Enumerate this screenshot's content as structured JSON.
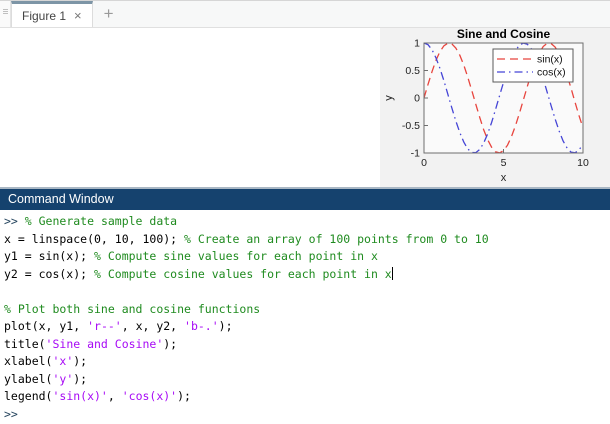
{
  "tab_bar": {
    "tabs": [
      {
        "label": "Figure 1",
        "close_glyph": "×",
        "active": true
      }
    ],
    "new_tab_glyph": "+"
  },
  "command_window": {
    "title": "Command Window",
    "lines": [
      [
        {
          "t": "prompt",
          "x": ">> "
        },
        {
          "t": "comment",
          "x": "% Generate sample data"
        }
      ],
      [
        {
          "t": "code",
          "x": "x = linspace(0, 10, 100); "
        },
        {
          "t": "comment",
          "x": "% Create an array of 100 points from 0 to 10"
        }
      ],
      [
        {
          "t": "code",
          "x": "y1 = sin(x); "
        },
        {
          "t": "comment",
          "x": "% Compute sine values for each point in x"
        }
      ],
      [
        {
          "t": "code",
          "x": "y2 = cos(x); "
        },
        {
          "t": "comment",
          "x": "% Compute cosine values for each point in x"
        },
        {
          "t": "cursor",
          "x": ""
        }
      ],
      [],
      [
        {
          "t": "comment",
          "x": "% Plot both sine and cosine functions"
        }
      ],
      [
        {
          "t": "code",
          "x": "plot(x, y1, "
        },
        {
          "t": "string",
          "x": "'r--'"
        },
        {
          "t": "code",
          "x": ", x, y2, "
        },
        {
          "t": "string",
          "x": "'b-.'"
        },
        {
          "t": "code",
          "x": ");"
        }
      ],
      [
        {
          "t": "code",
          "x": "title("
        },
        {
          "t": "string",
          "x": "'Sine and Cosine'"
        },
        {
          "t": "code",
          "x": ");"
        }
      ],
      [
        {
          "t": "code",
          "x": "xlabel("
        },
        {
          "t": "string",
          "x": "'x'"
        },
        {
          "t": "code",
          "x": ");"
        }
      ],
      [
        {
          "t": "code",
          "x": "ylabel("
        },
        {
          "t": "string",
          "x": "'y'"
        },
        {
          "t": "code",
          "x": ");"
        }
      ],
      [
        {
          "t": "code",
          "x": "legend("
        },
        {
          "t": "string",
          "x": "'sin(x)'"
        },
        {
          "t": "code",
          "x": ", "
        },
        {
          "t": "string",
          "x": "'cos(x)'"
        },
        {
          "t": "code",
          "x": ");"
        }
      ],
      [
        {
          "t": "prompt",
          "x": ">>"
        }
      ]
    ]
  },
  "colors": {
    "prompt": "#27465f",
    "code": "#000000",
    "comment": "#1f8b1f",
    "string": "#a709f5",
    "header_bg": "#15426e",
    "tab_accent": "#7d95a6"
  },
  "chart_data": {
    "type": "line",
    "title": "Sine and Cosine",
    "xlabel": "x",
    "ylabel": "y",
    "xlim": [
      0,
      10
    ],
    "ylim": [
      -1,
      1
    ],
    "xticks": [
      0,
      5,
      10
    ],
    "yticks": [
      1,
      0.5,
      0,
      -0.5,
      -1
    ],
    "grid": false,
    "legend_position": "northeast",
    "x": [
      0,
      0.25,
      0.5,
      0.75,
      1,
      1.25,
      1.5,
      1.75,
      2,
      2.25,
      2.5,
      2.75,
      3,
      3.25,
      3.5,
      3.75,
      4,
      4.25,
      4.5,
      4.75,
      5,
      5.25,
      5.5,
      5.75,
      6,
      6.25,
      6.5,
      6.75,
      7,
      7.25,
      7.5,
      7.75,
      8,
      8.25,
      8.5,
      8.75,
      9,
      9.25,
      9.5,
      9.75,
      10
    ],
    "series": [
      {
        "name": "sin(x)",
        "style_code": "r--",
        "color": "#e8453e",
        "linestyle": "dashed",
        "values": [
          0,
          0.247,
          0.479,
          0.682,
          0.841,
          0.949,
          0.997,
          0.984,
          0.909,
          0.778,
          0.599,
          0.382,
          0.141,
          -0.108,
          -0.351,
          -0.572,
          -0.757,
          -0.895,
          -0.978,
          -0.999,
          -0.959,
          -0.859,
          -0.706,
          -0.508,
          -0.279,
          -0.033,
          0.215,
          0.45,
          0.657,
          0.823,
          0.938,
          0.995,
          0.989,
          0.923,
          0.799,
          0.625,
          0.412,
          0.174,
          -0.075,
          -0.32,
          -0.544
        ]
      },
      {
        "name": "cos(x)",
        "style_code": "b-.",
        "color": "#4545d6",
        "linestyle": "dashdot",
        "values": [
          1,
          0.969,
          0.878,
          0.732,
          0.54,
          0.315,
          0.071,
          -0.178,
          -0.416,
          -0.628,
          -0.801,
          -0.924,
          -0.99,
          -0.994,
          -0.936,
          -0.821,
          -0.654,
          -0.446,
          -0.211,
          0.038,
          0.284,
          0.512,
          0.709,
          0.861,
          0.96,
          0.999,
          0.977,
          0.893,
          0.754,
          0.568,
          0.347,
          0.103,
          -0.146,
          -0.386,
          -0.602,
          -0.781,
          -0.911,
          -0.985,
          -0.997,
          -0.948,
          -0.839
        ]
      }
    ]
  }
}
